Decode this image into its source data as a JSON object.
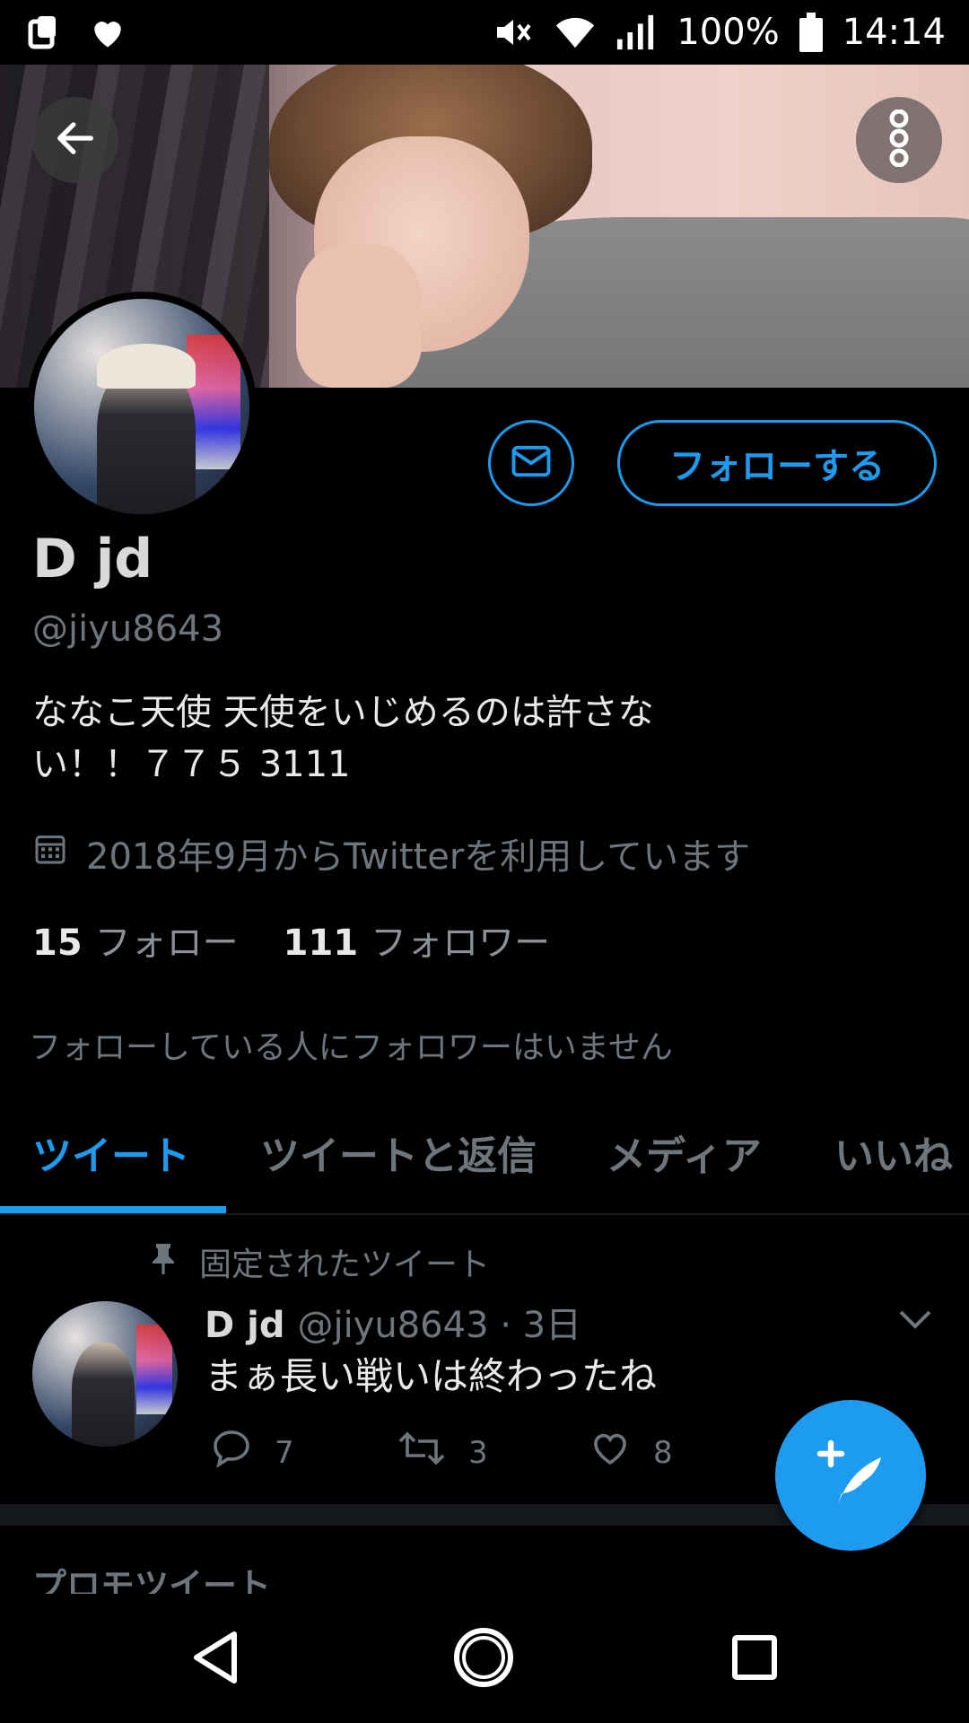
{
  "status_bar": {
    "battery_percent": "100%",
    "time": "14:14",
    "icons": [
      "clipboard-icon",
      "heart-icon",
      "mute-icon",
      "wifi-icon",
      "signal-icon",
      "battery-icon"
    ]
  },
  "profile": {
    "name": "D jd",
    "handle": "@jiyu8643",
    "bio": "ななこ天使 天使をいじめるのは許さな\nい！！７７５ 3111",
    "joined": "2018年9月からTwitterを利用しています",
    "following_count": "15",
    "following_label": "フォロー",
    "followers_count": "111",
    "followers_label": "フォロワー",
    "no_known_followers": "フォローしている人にフォロワーはいません",
    "follow_button": "フォローする"
  },
  "tabs": [
    {
      "label": "ツイート",
      "active": true
    },
    {
      "label": "ツイートと返信",
      "active": false
    },
    {
      "label": "メディア",
      "active": false
    },
    {
      "label": "いいね",
      "active": false
    }
  ],
  "pinned_tweet": {
    "pinned_label": "固定されたツイート",
    "author_name": "D jd",
    "author_handle_time": "@jiyu8643 · 3日",
    "text": "まぁ長い戦いは終わったね",
    "replies": "7",
    "retweets": "3",
    "likes": "8"
  },
  "promo_label": "プロモツイート",
  "colors": {
    "accent": "#1d9bf0",
    "background": "#000000",
    "muted_text": "#6e767d"
  }
}
